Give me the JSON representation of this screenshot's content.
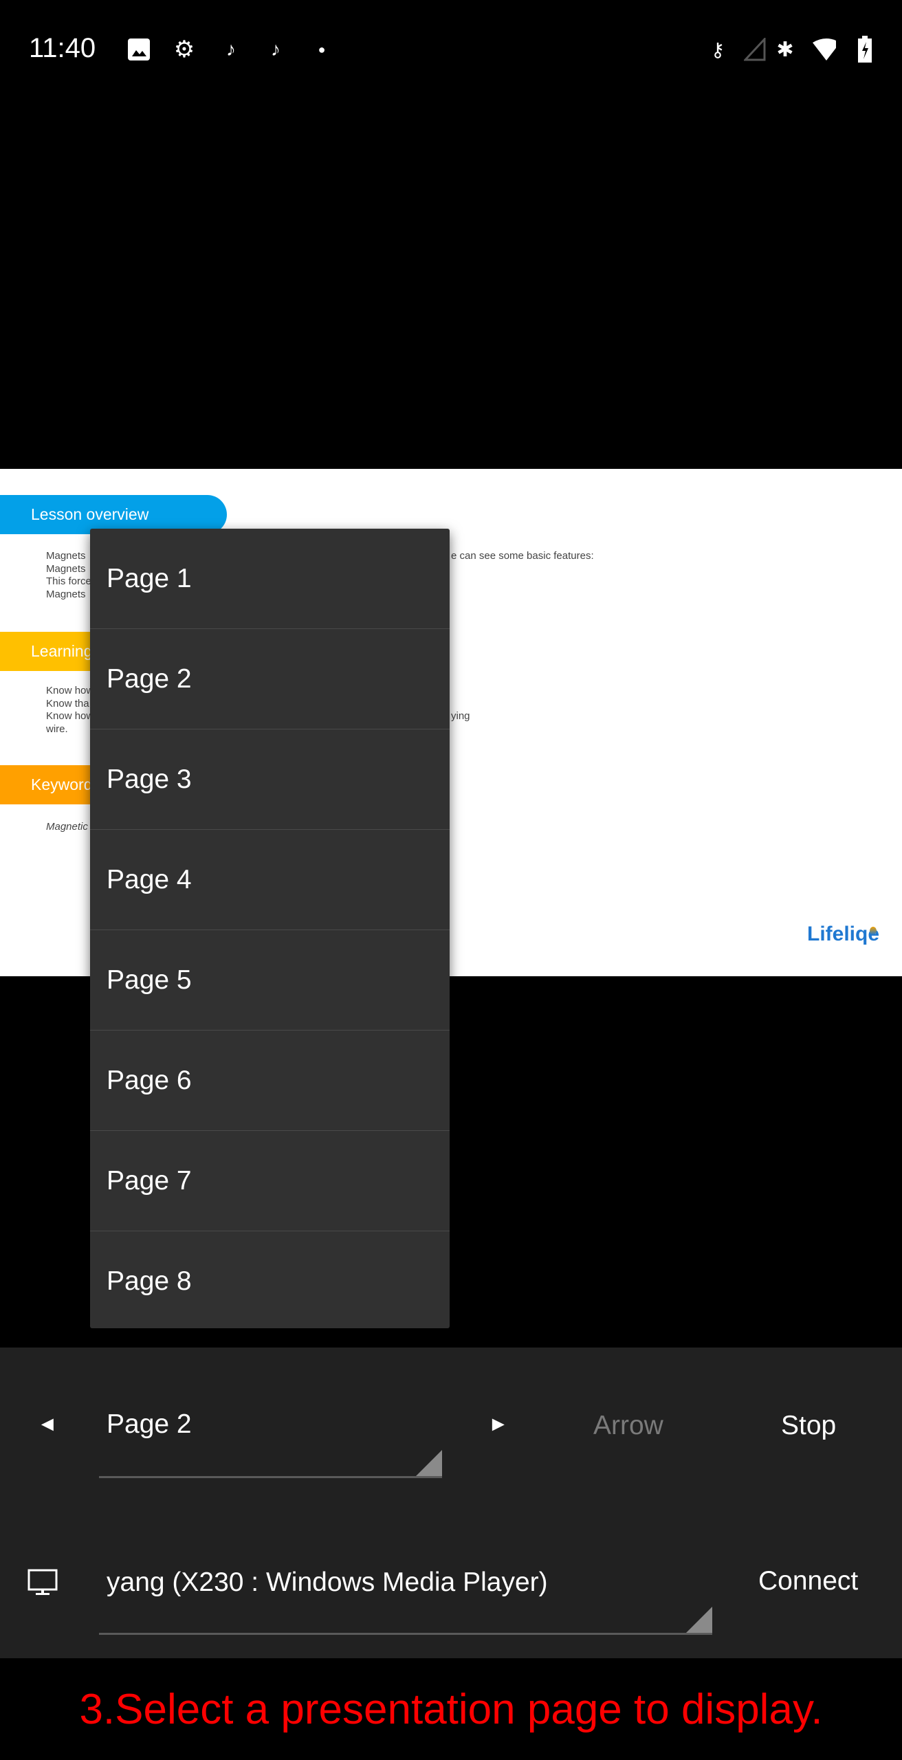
{
  "status_bar": {
    "time": "11:40",
    "left_icons": [
      "image-icon",
      "settings-gear-icon",
      "tiktok-icon",
      "tiktok-icon",
      "dot-icon"
    ],
    "right_icons": [
      "vpn-key-icon",
      "cell-signal-icon",
      "bluetooth-icon",
      "wifi-icon",
      "battery-charging-icon"
    ]
  },
  "slide": {
    "lesson_overview": "Lesson overview",
    "overview_lines": [
      "Magnets",
      "Magnets",
      "This force",
      "Magnets"
    ],
    "overview_right": "e can  see some basic features:",
    "learning": "Learning",
    "learning_lines": [
      "Know how",
      "Know tha",
      "Know how",
      "wire."
    ],
    "learning_right": "ying",
    "keywords": "Keyword",
    "keyword_line": "Magnetic",
    "logo": "Lifeliqe",
    "colors": {
      "overview": "#03a0e8",
      "learning": "#ffc000",
      "keywords": "#ffa000"
    }
  },
  "dropdown": {
    "items": [
      "Page 1",
      "Page 2",
      "Page 3",
      "Page 4",
      "Page 5",
      "Page 6",
      "Page 7",
      "Page 8"
    ]
  },
  "controls": {
    "prev": "◄",
    "selected_page": "Page 2",
    "next": "►",
    "arrow": "Arrow",
    "stop": "Stop",
    "device": "yang (X230 : Windows Media Player)",
    "connect": "Connect"
  },
  "caption": "3.Select a presentation page to display.",
  "colors": {
    "caption": "#ff0000",
    "panel": "#212121",
    "dropdown": "#313131"
  }
}
